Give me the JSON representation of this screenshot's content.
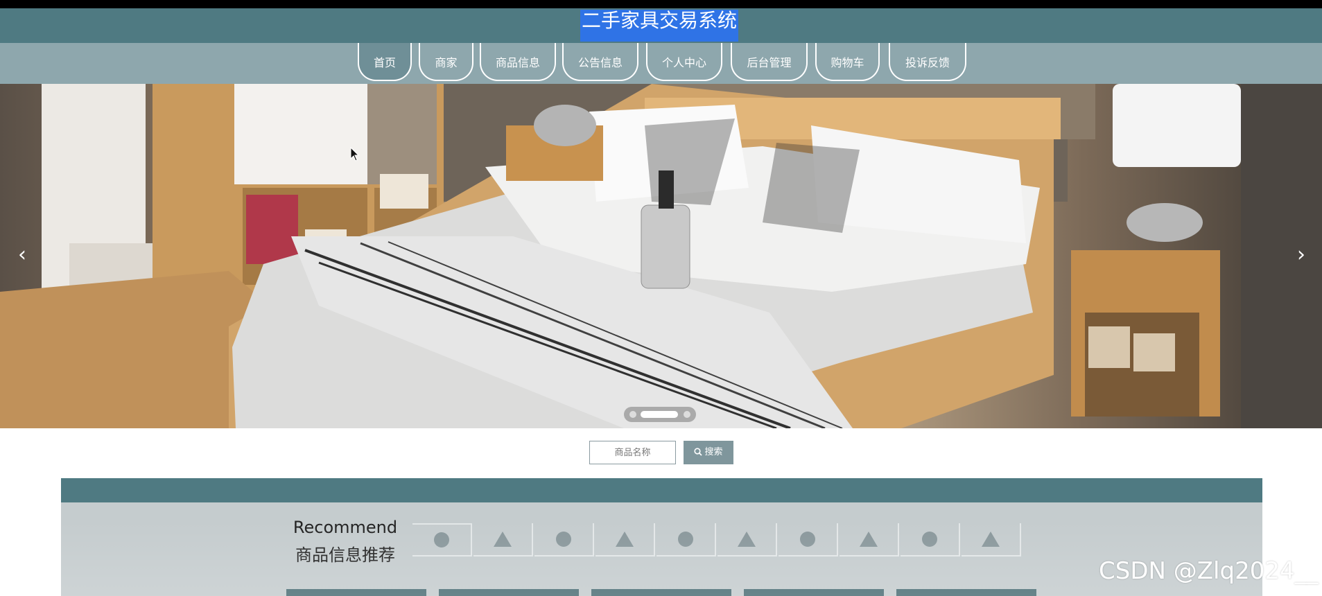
{
  "header": {
    "title": "二手家具交易系统"
  },
  "nav": {
    "items": [
      {
        "label": "首页",
        "active": true
      },
      {
        "label": "商家"
      },
      {
        "label": "商品信息"
      },
      {
        "label": "公告信息"
      },
      {
        "label": "个人中心"
      },
      {
        "label": "后台管理"
      },
      {
        "label": "购物车"
      },
      {
        "label": "投诉反馈"
      }
    ]
  },
  "carousel": {
    "prev_icon": "chevron-left-icon",
    "next_icon": "chevron-right-icon",
    "prev_glyph": "‹",
    "next_glyph": "›",
    "slide_count": 3,
    "active_slide": 2
  },
  "search": {
    "placeholder": "商品名称",
    "button_label": "搜索",
    "icon": "search-icon"
  },
  "recommend": {
    "title_en": "Recommend",
    "title_cn": "商品信息推荐",
    "tabs": [
      "circle",
      "triangle",
      "circle",
      "triangle",
      "circle",
      "triangle",
      "circle",
      "triangle",
      "circle",
      "triangle"
    ]
  },
  "watermark": "CSDN @Zlq2024__",
  "colors": {
    "header_bg": "#4f7a82",
    "nav_bg": "#8ea7ad",
    "title_highlight": "#2f73e6",
    "button_bg": "#7f969c",
    "shape_gray": "#8a989c"
  }
}
